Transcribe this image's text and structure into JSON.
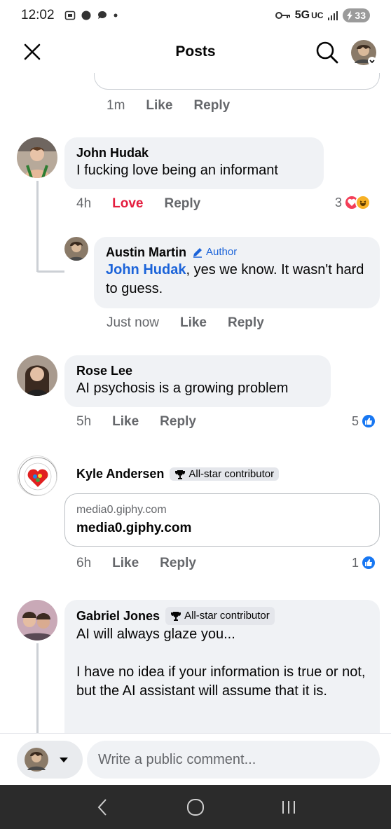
{
  "status": {
    "time": "12:02",
    "network": "5G",
    "network_sub": "UC",
    "battery": "33"
  },
  "header": {
    "title": "Posts"
  },
  "top_meta": {
    "time": "1m",
    "like": "Like",
    "reply": "Reply"
  },
  "comments": [
    {
      "name": "John Hudak",
      "text": "I fucking love being an informant",
      "time": "4h",
      "reaction_label": "Love",
      "reply": "Reply",
      "reaction_count": "3"
    },
    {
      "name": "Austin Martin",
      "badge": "Author",
      "mention": "John Hudak",
      "text": ", yes we know. It wasn't hard to guess.",
      "time": "Just now",
      "like": "Like",
      "reply": "Reply"
    },
    {
      "name": "Rose Lee",
      "text": "AI psychosis is a growing problem",
      "time": "5h",
      "like": "Like",
      "reply": "Reply",
      "reaction_count": "5"
    },
    {
      "name": "Kyle Andersen",
      "badge": "All-star contributor",
      "link_domain": "media0.giphy.com",
      "link_title": "media0.giphy.com",
      "time": "6h",
      "like": "Like",
      "reply": "Reply",
      "reaction_count": "1"
    },
    {
      "name": "Gabriel Jones",
      "badge": "All-star contributor",
      "text_1": "AI will always glaze you...",
      "text_2": "I have no idea if your information is true or not, but the AI assistant will assume that it is."
    }
  ],
  "compose": {
    "placeholder": "Write a public comment..."
  },
  "colors": {
    "love": "#e41e3f",
    "like_blue": "#1877f2",
    "mention": "#1b63d9",
    "bubble_bg": "#f0f2f5"
  }
}
